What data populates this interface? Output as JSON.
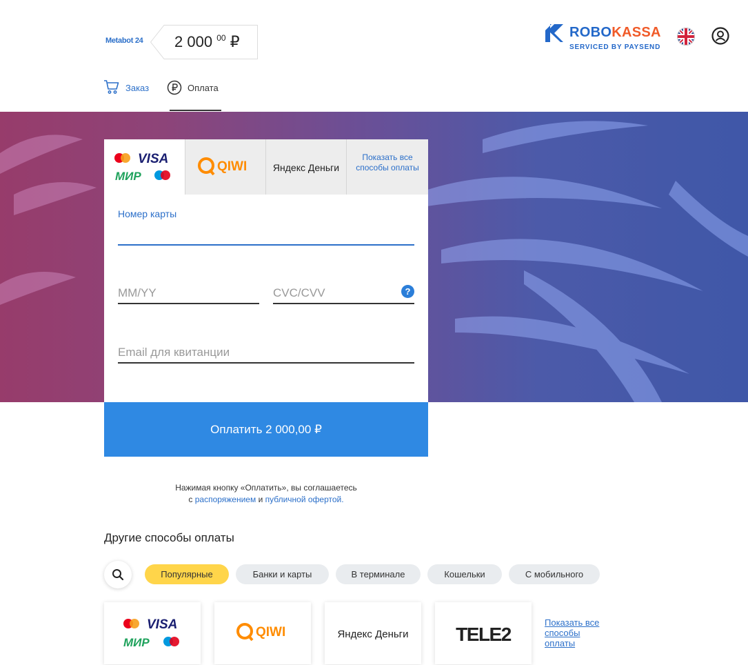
{
  "header": {
    "merchant": "Metabot 24",
    "amount_main": "2 000",
    "amount_cents": "00",
    "currency": "₽",
    "logo_part1": "ROBO",
    "logo_part2": "KASSA",
    "logo_sub": "SERVICED BY PAYSEND"
  },
  "nav": {
    "order_label": "Заказ",
    "pay_label": "Оплата"
  },
  "tabs": {
    "visa": "VISA",
    "mir": "МИР",
    "qiwi": "QIWI",
    "yandex": "Яндекс Деньги",
    "show_all": "Показать все способы оплаты"
  },
  "form": {
    "card_label": "Номер карты",
    "mmyy_placeholder": "MM/YY",
    "cvc_placeholder": "CVC/CVV",
    "help_symbol": "?",
    "email_placeholder": "Email для квитанции"
  },
  "pay_button": "Оплатить 2 000,00 ₽",
  "agreement": {
    "line1": "Нажимая кнопку «Оплатить», вы соглашаетесь",
    "pre": "с",
    "link1": "распоряжением",
    "and": "и",
    "link2": "публичной офертой",
    "dot": "."
  },
  "other": {
    "title": "Другие способы оплаты",
    "chips": [
      "Популярные",
      "Банки и карты",
      "В терминале",
      "Кошельки",
      "С мобильного"
    ],
    "tiles": {
      "visa": "VISA",
      "mir": "МИР",
      "qiwi": "QIWI",
      "yandex": "Яндекс Деньги",
      "tele2": "TELE2"
    },
    "show_all": "Показать все способы оплаты"
  },
  "colors": {
    "accent": "#2f89e3",
    "link": "#2b6fc9",
    "chip_selected": "#ffd54a",
    "robo_blue": "#2368c9",
    "kassa_orange": "#f05a28",
    "qiwi_orange": "#ff8c00",
    "mir_green": "#1fa25c"
  }
}
